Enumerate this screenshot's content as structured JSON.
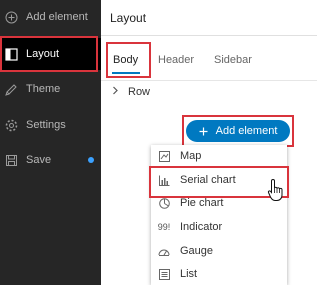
{
  "sidebar": {
    "items": [
      {
        "label": "Add element",
        "icon": "add-element-icon"
      },
      {
        "label": "Layout",
        "icon": "layout-icon",
        "active": true
      },
      {
        "label": "Theme",
        "icon": "theme-icon"
      },
      {
        "label": "Settings",
        "icon": "gear-icon"
      },
      {
        "label": "Save",
        "icon": "save-icon",
        "has_unsaved_indicator": true
      }
    ]
  },
  "main": {
    "title": "Layout",
    "tabs": [
      {
        "label": "Body",
        "active": true
      },
      {
        "label": "Header"
      },
      {
        "label": "Sidebar"
      }
    ],
    "tree": {
      "row_label": "Row"
    },
    "add_button": {
      "label": "Add element"
    },
    "menu": {
      "items": [
        {
          "label": "Map",
          "icon": "map-icon"
        },
        {
          "label": "Serial chart",
          "icon": "serial-chart-icon",
          "hovered": true
        },
        {
          "label": "Pie chart",
          "icon": "pie-chart-icon"
        },
        {
          "label": "Indicator",
          "icon": "indicator-icon",
          "glyph": "99!"
        },
        {
          "label": "Gauge",
          "icon": "gauge-icon"
        },
        {
          "label": "List",
          "icon": "list-icon"
        }
      ]
    }
  },
  "colors": {
    "sidebar_bg": "#262626",
    "sidebar_active_bg": "#000000",
    "accent": "#0079c1",
    "highlight": "#d9343c",
    "unsaved_dot": "#3ba1ff"
  }
}
